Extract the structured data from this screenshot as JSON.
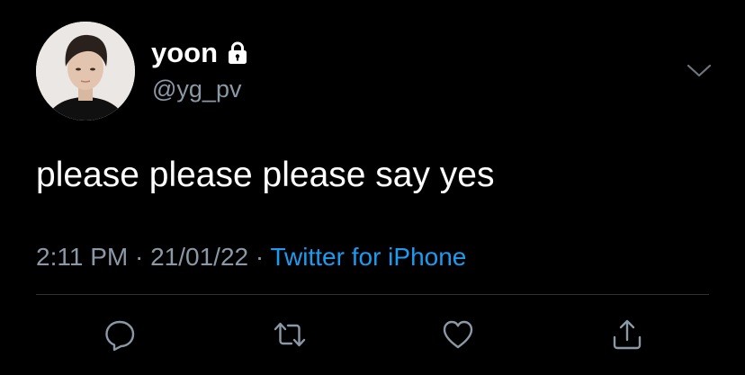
{
  "author": {
    "display_name": "yoon",
    "handle": "@yg_pv",
    "protected_icon": "lock-icon",
    "avatar_icon": "profile-photo"
  },
  "menu": {
    "icon": "chevron-down-icon"
  },
  "tweet": {
    "text": "please please please say yes",
    "time": "2:11 PM",
    "separator_1": " · ",
    "date": "21/01/22",
    "separator_2": " · ",
    "source": "Twitter for iPhone"
  },
  "actions": [
    {
      "name": "reply",
      "icon": "reply-icon"
    },
    {
      "name": "retweet",
      "icon": "retweet-icon"
    },
    {
      "name": "like",
      "icon": "heart-icon"
    },
    {
      "name": "share",
      "icon": "share-icon"
    }
  ],
  "colors": {
    "background": "#000000",
    "primary_text": "#ffffff",
    "secondary_text": "#8b98a5",
    "link": "#1d9bf0",
    "divider": "#2f3336"
  }
}
